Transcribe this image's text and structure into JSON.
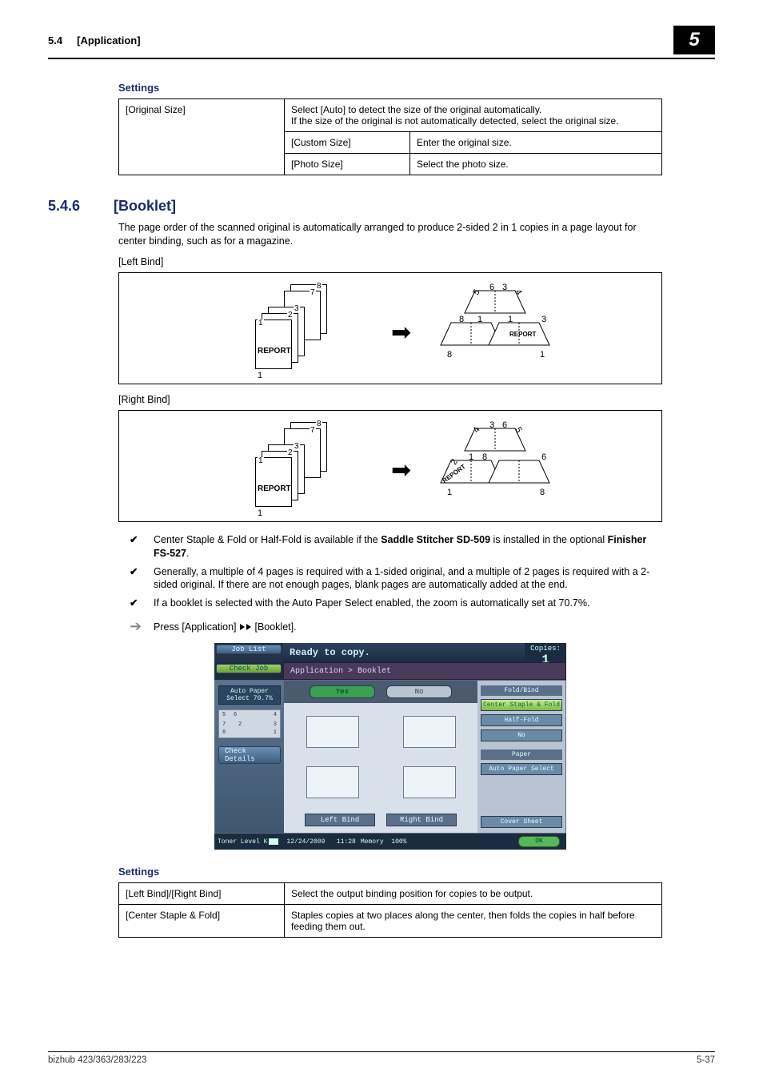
{
  "header": {
    "section_num": "5.4",
    "section_title": "[Application]",
    "chapter_num": "5"
  },
  "settings1": {
    "heading": "Settings",
    "row1_key": "[Original Size]",
    "row1_desc": "Select [Auto] to detect the size of the original automatically.\nIf the size of the original is not automatically detected, select the original size.",
    "row2_key": "[Custom Size]",
    "row2_val": "Enter the original size.",
    "row3_key": "[Photo Size]",
    "row3_val": "Select the photo size."
  },
  "subsection": {
    "num": "5.4.6",
    "title": "[Booklet]"
  },
  "body": {
    "intro": "The page order of the scanned original is automatically arranged to produce 2-sided 2 in 1 copies in a page layout for center binding, such as for a magazine.",
    "leftbind_label": "[Left Bind]",
    "rightbind_label": "[Right Bind]"
  },
  "diagram": {
    "num1": "1",
    "num2": "2",
    "num3": "3",
    "num7": "7",
    "num8": "8",
    "num6": "6",
    "num5": "5",
    "num4": "4",
    "report": "REPORT"
  },
  "notes": {
    "n1a": "Center Staple & Fold or Half-Fold is available if the ",
    "n1b": "Saddle Stitcher SD-509",
    "n1c": " is installed in the optional ",
    "n1d": "Finisher FS-527",
    "n1e": ".",
    "n2": "Generally, a multiple of 4 pages is required with a 1-sided original, and a multiple of 2 pages is required with a 2-sided original. If there are not enough pages, blank pages are automatically added at the end.",
    "n3": "If a booklet is selected with the Auto Paper Select enabled, the zoom is automatically set at 70.7%."
  },
  "step": {
    "prefix": "Press [Application] ",
    "suffix": " [Booklet]."
  },
  "shot": {
    "joblist": "Job List",
    "checkjob": "Check Job",
    "ready": "Ready to copy.",
    "copies_label": "Copies:",
    "copies_value": "1",
    "crumb": "Application > Booklet",
    "yes": "Yes",
    "no": "No",
    "aps": "Auto Paper Select",
    "aps_val": "70.7%",
    "checkdetails": "Check Details",
    "leftbind": "Left Bind",
    "rightbind": "Right Bind",
    "rp_head1": "Fold/Bind",
    "rp_b1": "Center Staple & Fold",
    "rp_b2": "Half-Fold",
    "rp_b3": "No",
    "rp_head2": "Paper",
    "rp_b4": "Auto Paper Select",
    "rp_b5": "Cover Sheet",
    "toner": "Toner Level  K",
    "date": "12/24/2009",
    "time": "11:28",
    "memory": "Memory",
    "mem_val": "100%",
    "ok": "OK",
    "side_nums": "5 6 4\\n7 2 3\\n8 1"
  },
  "settings2": {
    "heading": "Settings",
    "r1k": "[Left Bind]/[Right Bind]",
    "r1v": "Select the output binding position for copies to be output.",
    "r2k": "[Center Staple & Fold]",
    "r2v": "Staples copies at two places along the center, then folds the copies in half before feeding them out."
  },
  "footer": {
    "left": "bizhub 423/363/283/223",
    "right": "5-37"
  }
}
